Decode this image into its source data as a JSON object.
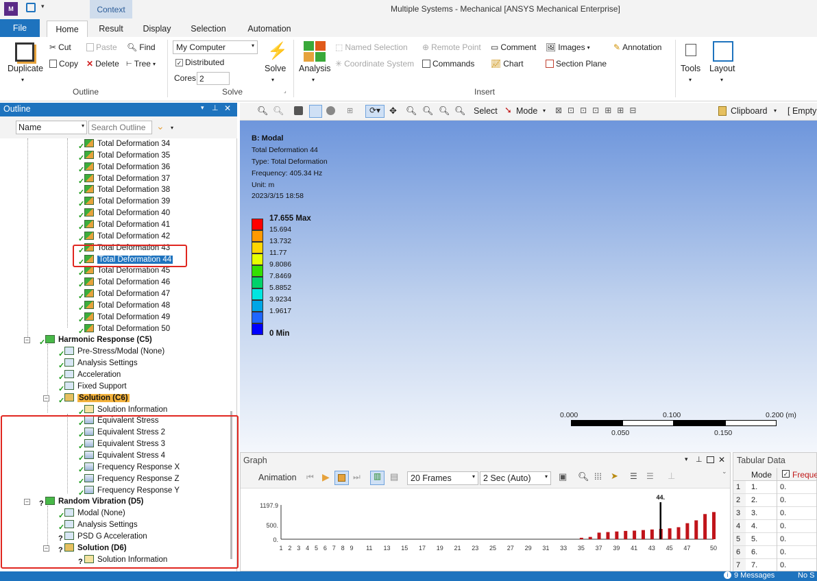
{
  "app": {
    "title": "Multiple Systems - Mechanical [ANSYS Mechanical Enterprise]",
    "context_tab": "Context"
  },
  "tabs": [
    "File",
    "Home",
    "Result",
    "Display",
    "Selection",
    "Automation"
  ],
  "ribbon": {
    "duplicate": "Duplicate",
    "cut": "Cut",
    "copy": "Copy",
    "paste": "Paste",
    "delete": "Delete",
    "find": "Find",
    "tree": "Tree",
    "outline_group": "Outline",
    "computer": "My Computer",
    "distributed": "Distributed",
    "cores_label": "Cores",
    "cores_value": "2",
    "solve": "Solve",
    "solve_group": "Solve",
    "analysis": "Analysis",
    "named_selection": "Named Selection",
    "coordinate_system": "Coordinate System",
    "remote_point": "Remote Point",
    "commands": "Commands",
    "comment": "Comment",
    "chart": "Chart",
    "images": "Images",
    "section_plane": "Section Plane",
    "annotation": "Annotation",
    "insert_group": "Insert",
    "tools": "Tools",
    "layout": "Layout"
  },
  "outline": {
    "title": "Outline",
    "filter_name": "Name",
    "search_placeholder": "Search Outline",
    "deformations": [
      "Total Deformation 34",
      "Total Deformation 35",
      "Total Deformation 36",
      "Total Deformation 37",
      "Total Deformation 38",
      "Total Deformation 39",
      "Total Deformation 40",
      "Total Deformation 41",
      "Total Deformation 42",
      "Total Deformation 43",
      "Total Deformation 44",
      "Total Deformation 45",
      "Total Deformation 46",
      "Total Deformation 47",
      "Total Deformation 48",
      "Total Deformation 49",
      "Total Deformation 50"
    ],
    "selected": "Total Deformation 44",
    "harmonic": "Harmonic Response (C5)",
    "harmonic_children": [
      "Pre-Stress/Modal (None)",
      "Analysis Settings",
      "Acceleration",
      "Fixed Support"
    ],
    "solution_c6": "Solution (C6)",
    "c6_children": [
      "Solution Information",
      "Equivalent Stress",
      "Equivalent Stress 2",
      "Equivalent Stress 3",
      "Equivalent Stress 4",
      "Frequency Response X",
      "Frequency Response Z",
      "Frequency Response Y"
    ],
    "random": "Random Vibration (D5)",
    "random_children": [
      "Modal (None)",
      "Analysis Settings",
      "PSD G Acceleration"
    ],
    "solution_d6": "Solution (D6)",
    "d6_children": [
      "Solution Information"
    ]
  },
  "gfx_toolbar": {
    "select": "Select",
    "mode": "Mode",
    "clipboard": "Clipboard",
    "empty": "[ Empty"
  },
  "viewport": {
    "system": "B: Modal",
    "result": "Total Deformation 44",
    "type": "Type: Total Deformation",
    "frequency": "Frequency: 405.34 Hz",
    "unit": "Unit: m",
    "date": "2023/3/15 18:58",
    "legend_labels": [
      "17.655 Max",
      "15.694",
      "13.732",
      "11.77",
      "9.8086",
      "7.8469",
      "5.8852",
      "3.9234",
      "1.9617",
      "0 Min"
    ],
    "legend_colors": [
      "#ff0000",
      "#ff9900",
      "#ffd600",
      "#e6ff00",
      "#33e000",
      "#00d26a",
      "#00e6e0",
      "#00a6e6",
      "#1f66ff",
      "#0000ff"
    ],
    "scale_top": [
      "0.000",
      "0.100",
      "0.200 (m)"
    ],
    "scale_bottom": [
      "0.050",
      "0.150"
    ]
  },
  "graph": {
    "title": "Graph",
    "animation": "Animation",
    "frames": "20 Frames",
    "duration": "2 Sec (Auto)",
    "marker": "44."
  },
  "chart_data": {
    "type": "bar",
    "yticks": [
      "1197.9",
      "500.",
      "0."
    ],
    "ylim": [
      0,
      1197.9
    ],
    "xticks": [
      "1",
      "2",
      "3",
      "4",
      "5",
      "6",
      "7",
      "8",
      "9",
      "11",
      "13",
      "15",
      "17",
      "19",
      "21",
      "23",
      "25",
      "27",
      "29",
      "31",
      "33",
      "35",
      "37",
      "39",
      "41",
      "43",
      "45",
      "47",
      "50"
    ],
    "categories": [
      35,
      36,
      37,
      38,
      39,
      40,
      41,
      42,
      43,
      44,
      45,
      46,
      47,
      48,
      49,
      50
    ],
    "values": [
      50,
      80,
      230,
      250,
      270,
      290,
      300,
      320,
      340,
      360,
      380,
      420,
      560,
      660,
      880,
      950
    ],
    "selected_mode": 44,
    "bar_color": "#c0141a",
    "marker_color": "#000000"
  },
  "tabular": {
    "title": "Tabular Data",
    "headers": [
      "Mode",
      "Freque"
    ],
    "rows": [
      [
        "1",
        "1.",
        "0."
      ],
      [
        "2",
        "2.",
        "0."
      ],
      [
        "3",
        "3.",
        "0."
      ],
      [
        "4",
        "4.",
        "0."
      ],
      [
        "5",
        "5.",
        "0."
      ],
      [
        "6",
        "6.",
        "0."
      ],
      [
        "7",
        "7.",
        "0."
      ]
    ]
  },
  "status": {
    "messages": "9 Messages",
    "right": "No S"
  }
}
